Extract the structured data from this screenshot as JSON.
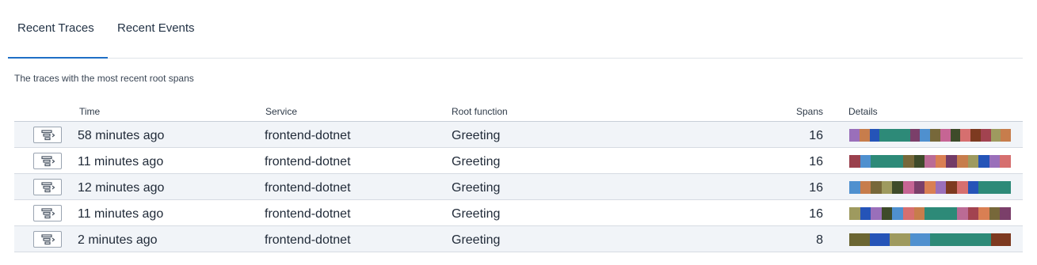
{
  "tabs": [
    {
      "label": "Recent Traces"
    },
    {
      "label": "Recent Events"
    }
  ],
  "subtitle": "The traces with the most recent root spans",
  "table": {
    "headers": {
      "time": "Time",
      "service": "Service",
      "root_function": "Root function",
      "spans": "Spans",
      "details": "Details"
    },
    "rows": [
      {
        "time": "58 minutes ago",
        "service": "frontend-dotnet",
        "root_function": "Greeting",
        "spans": "16",
        "segments": [
          {
            "color": "#9a6fba",
            "w": 1
          },
          {
            "color": "#c77d4c",
            "w": 1
          },
          {
            "color": "#2554b8",
            "w": 1
          },
          {
            "color": "#2d8a78",
            "w": 3
          },
          {
            "color": "#7b3f6a",
            "w": 1
          },
          {
            "color": "#4f90cf",
            "w": 1
          },
          {
            "color": "#77683a",
            "w": 1
          },
          {
            "color": "#c66594",
            "w": 1
          },
          {
            "color": "#3e4b2a",
            "w": 1
          },
          {
            "color": "#d66f6f",
            "w": 1
          },
          {
            "color": "#7d3a20",
            "w": 1
          },
          {
            "color": "#a24350",
            "w": 1
          },
          {
            "color": "#9e9a5f",
            "w": 1
          },
          {
            "color": "#c77d4c",
            "w": 1
          }
        ]
      },
      {
        "time": "11 minutes ago",
        "service": "frontend-dotnet",
        "root_function": "Greeting",
        "spans": "16",
        "segments": [
          {
            "color": "#9a404d",
            "w": 1
          },
          {
            "color": "#4f90cf",
            "w": 1
          },
          {
            "color": "#2d8a78",
            "w": 3
          },
          {
            "color": "#77683a",
            "w": 1
          },
          {
            "color": "#3e4b2a",
            "w": 1
          },
          {
            "color": "#bb6b95",
            "w": 1
          },
          {
            "color": "#d97f53",
            "w": 1
          },
          {
            "color": "#733b66",
            "w": 1
          },
          {
            "color": "#c77d4c",
            "w": 1
          },
          {
            "color": "#9e9a5f",
            "w": 1
          },
          {
            "color": "#2554b8",
            "w": 1
          },
          {
            "color": "#9a6fba",
            "w": 1
          },
          {
            "color": "#d66f6f",
            "w": 1
          }
        ]
      },
      {
        "time": "12 minutes ago",
        "service": "frontend-dotnet",
        "root_function": "Greeting",
        "spans": "16",
        "segments": [
          {
            "color": "#4f90cf",
            "w": 1
          },
          {
            "color": "#c77d4c",
            "w": 1
          },
          {
            "color": "#77683a",
            "w": 1
          },
          {
            "color": "#9e9a5f",
            "w": 1
          },
          {
            "color": "#3e4b2a",
            "w": 1
          },
          {
            "color": "#c66594",
            "w": 1
          },
          {
            "color": "#7b3f6a",
            "w": 1
          },
          {
            "color": "#d97f53",
            "w": 1
          },
          {
            "color": "#9a6fba",
            "w": 1
          },
          {
            "color": "#7d3a20",
            "w": 1
          },
          {
            "color": "#d66f6f",
            "w": 1
          },
          {
            "color": "#2554b8",
            "w": 1
          },
          {
            "color": "#2d8a78",
            "w": 3
          }
        ]
      },
      {
        "time": "11 minutes ago",
        "service": "frontend-dotnet",
        "root_function": "Greeting",
        "spans": "16",
        "segments": [
          {
            "color": "#9e9a5f",
            "w": 1
          },
          {
            "color": "#2554b8",
            "w": 1
          },
          {
            "color": "#9a6fba",
            "w": 1
          },
          {
            "color": "#3e4b2a",
            "w": 1
          },
          {
            "color": "#4f90cf",
            "w": 1
          },
          {
            "color": "#d66f6f",
            "w": 1
          },
          {
            "color": "#c77d4c",
            "w": 1
          },
          {
            "color": "#2d8a78",
            "w": 3
          },
          {
            "color": "#bb6b95",
            "w": 1
          },
          {
            "color": "#a24350",
            "w": 1
          },
          {
            "color": "#d97f53",
            "w": 1
          },
          {
            "color": "#77683a",
            "w": 1
          },
          {
            "color": "#7b3f6a",
            "w": 1
          }
        ]
      },
      {
        "time": "2 minutes ago",
        "service": "frontend-dotnet",
        "root_function": "Greeting",
        "spans": "8",
        "segments": [
          {
            "color": "#6b6633",
            "w": 2
          },
          {
            "color": "#2554b8",
            "w": 2
          },
          {
            "color": "#9e9a5f",
            "w": 2
          },
          {
            "color": "#4f90cf",
            "w": 2
          },
          {
            "color": "#2d8a78",
            "w": 6
          },
          {
            "color": "#7d3a20",
            "w": 2
          }
        ]
      }
    ]
  }
}
